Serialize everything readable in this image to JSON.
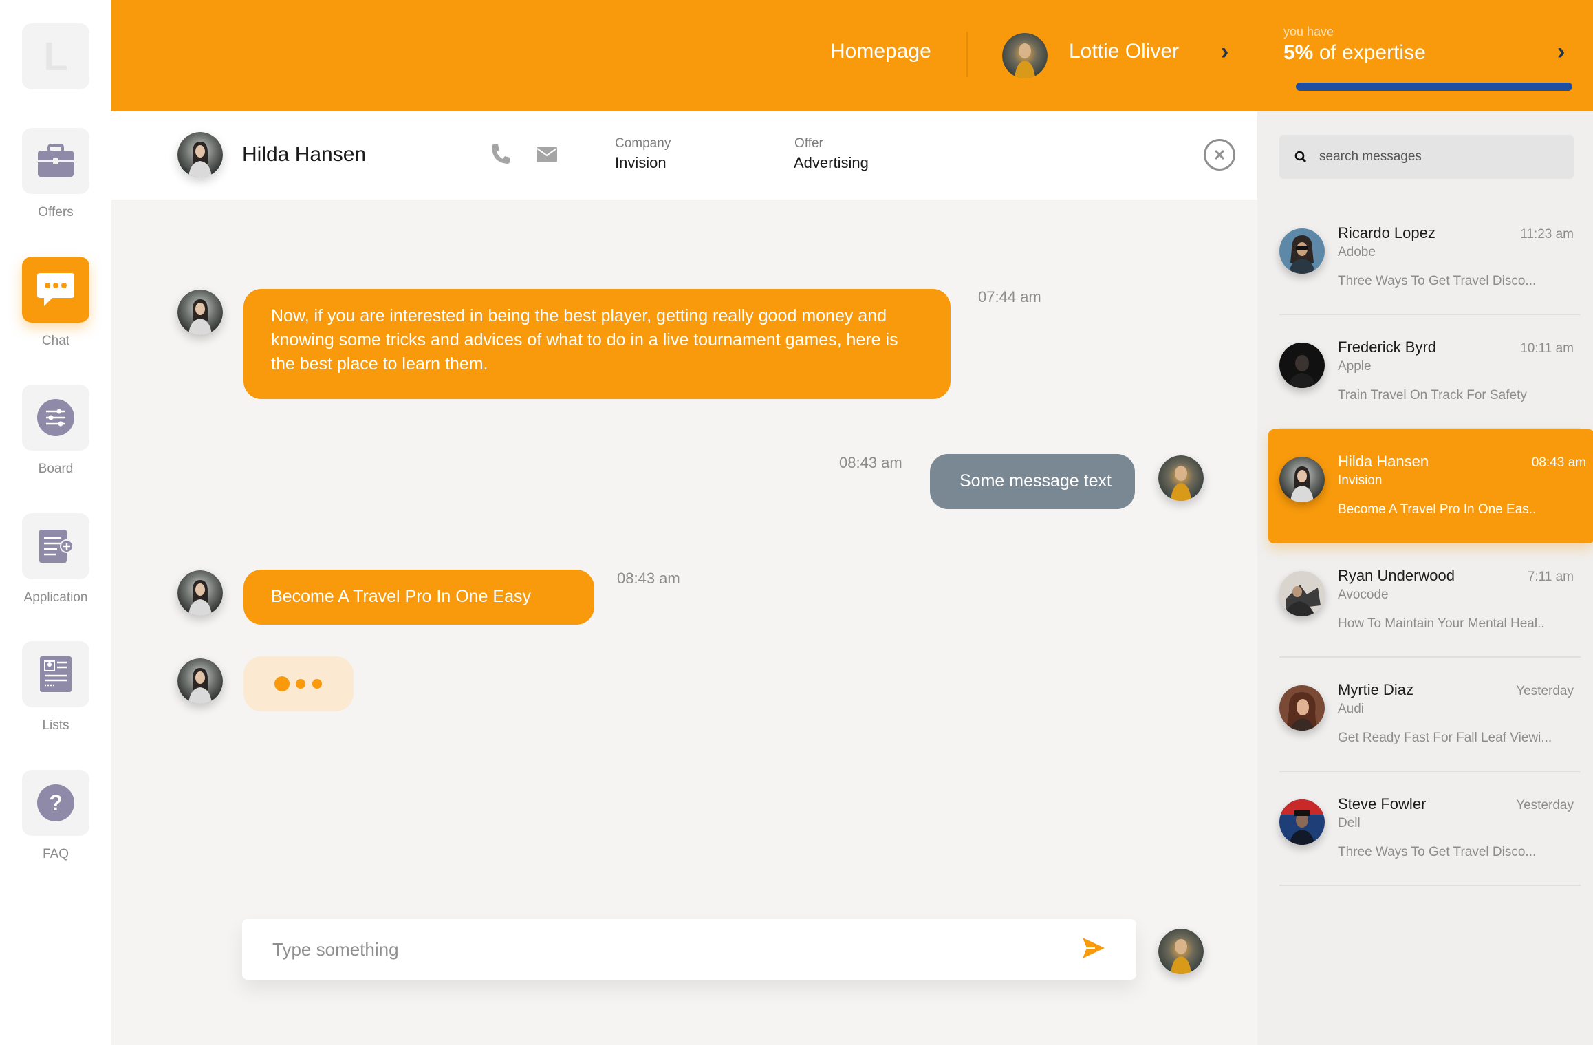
{
  "colors": {
    "accent": "#f99a0c",
    "progress": "#1e4fa0",
    "grey_bubble": "#7a8894"
  },
  "sidebar": {
    "logo_letter": "L",
    "items": [
      {
        "label": "Offers",
        "icon": "briefcase-icon",
        "active": false
      },
      {
        "label": "Chat",
        "icon": "chat-bubble-icon",
        "active": true
      },
      {
        "label": "Board",
        "icon": "sliders-icon",
        "active": false
      },
      {
        "label": "Application",
        "icon": "document-add-icon",
        "active": false
      },
      {
        "label": "Lists",
        "icon": "list-card-icon",
        "active": false
      },
      {
        "label": "FAQ",
        "icon": "question-icon",
        "active": false
      }
    ]
  },
  "topbar": {
    "home_label": "Homepage",
    "user_name": "Lottie Oliver",
    "expertise_small": "you have",
    "expertise_percent": "5%",
    "expertise_suffix": " of expertise",
    "progress_percent": 100
  },
  "chat_header": {
    "contact_name": "Hilda Hansen",
    "company_label": "Company",
    "company_value": "Invision",
    "offer_label": "Offer",
    "offer_value": "Advertising"
  },
  "messages": [
    {
      "from": "contact",
      "text": "Now, if you are interested in being the best player, getting really good money and knowing some tricks and advices of what to do in a live tournament games, here is the best place to learn them.",
      "time": "07:44 am"
    },
    {
      "from": "me",
      "text": "Some message text",
      "time": "08:43 am"
    },
    {
      "from": "contact",
      "text": "Become A Travel Pro In One Easy",
      "time": "08:43 am"
    }
  ],
  "composer": {
    "placeholder": "Type something"
  },
  "search": {
    "placeholder": "search messages"
  },
  "contacts": [
    {
      "name": "Ricardo Lopez",
      "company": "Adobe",
      "time": "11:23 am",
      "preview": "Three Ways To Get Travel Disco...",
      "active": false
    },
    {
      "name": "Frederick Byrd",
      "company": "Apple",
      "time": "10:11 am",
      "preview": "Train Travel On Track For Safety",
      "active": false
    },
    {
      "name": "Hilda Hansen",
      "company": "Invision",
      "time": "08:43 am",
      "preview": "Become A Travel Pro In One Eas..",
      "active": true
    },
    {
      "name": "Ryan Underwood",
      "company": "Avocode",
      "time": "7:11 am",
      "preview": "How To Maintain Your Mental Heal..",
      "active": false
    },
    {
      "name": "Myrtie Diaz",
      "company": "Audi",
      "time": "Yesterday",
      "preview": "Get Ready Fast For Fall Leaf Viewi...",
      "active": false
    },
    {
      "name": "Steve Fowler",
      "company": "Dell",
      "time": "Yesterday",
      "preview": "Three Ways To Get Travel Disco...",
      "active": false
    }
  ]
}
